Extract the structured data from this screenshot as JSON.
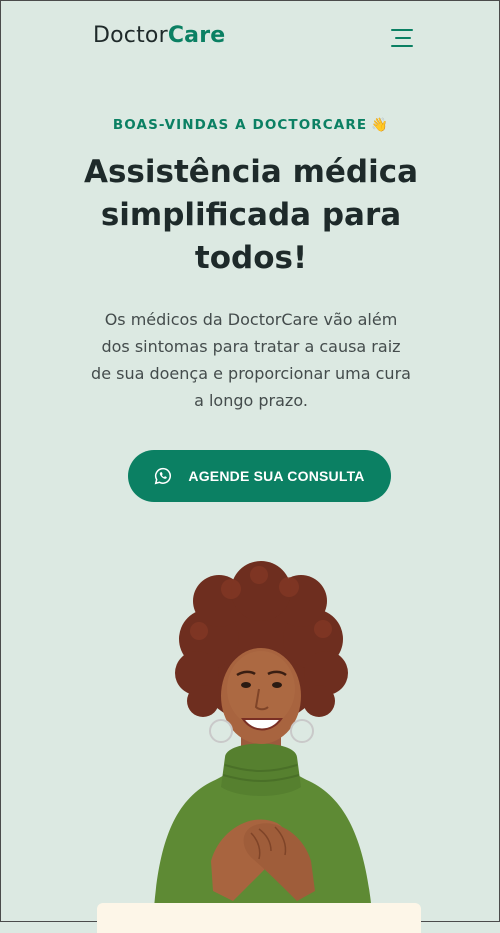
{
  "header": {
    "logo_regular": "Doctor",
    "logo_strong": "Care",
    "menu_icon": "hamburger-menu-icon"
  },
  "hero": {
    "eyebrow": "BOAS-VINDAS A DOCTORCARE",
    "eyebrow_emoji": "👋",
    "title": "Assistência médica simplificada para todos!",
    "description": "Os médicos da DoctorCare vão além dos sintomas para tratar a causa raiz de sua doença e proporcionar uma cura a longo prazo.",
    "cta_label": "AGENDE SUA CONSULTA",
    "cta_icon": "whatsapp-icon"
  },
  "colors": {
    "background": "#dce9e2",
    "brand": "#0b8063",
    "text": "#1e2a2a"
  }
}
